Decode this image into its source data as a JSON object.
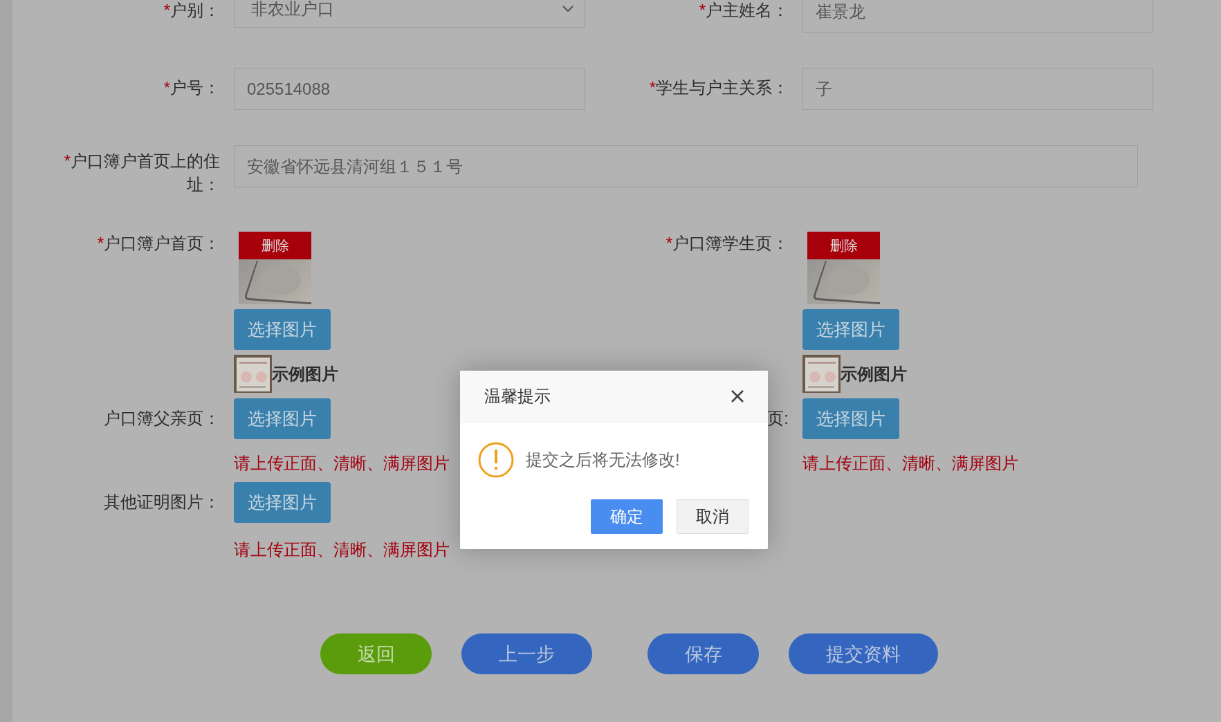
{
  "form": {
    "rows": [
      {
        "fields": [
          {
            "mark": "*",
            "label": "户别：",
            "kind": "select",
            "value": "非农业户口"
          },
          {
            "mark": "*",
            "label": "户主姓名：",
            "kind": "text",
            "value": "崔景龙"
          }
        ]
      },
      {
        "fields": [
          {
            "mark": "*",
            "label": "户号：",
            "kind": "text",
            "value": "025514088"
          },
          {
            "mark": "*",
            "label": "学生与户主关系：",
            "kind": "text",
            "value": "子"
          }
        ]
      },
      {
        "fields": [
          {
            "mark": "*",
            "label": "户口簿户首页上的住址：",
            "kind": "wide",
            "value": "安徽省怀远县清河组１５１号"
          }
        ]
      }
    ],
    "uploads": [
      {
        "items": [
          {
            "mark": "*",
            "label": "户口簿户首页：",
            "delete": "删除",
            "button": "选择图片",
            "example": "示例图片"
          },
          {
            "mark": "*",
            "label": "户口簿学生页：",
            "delete": "删除",
            "button": "选择图片",
            "example": "示例图片"
          }
        ]
      },
      {
        "items": [
          {
            "label": "户口簿父亲页：",
            "button": "选择图片",
            "hint": "请上传正面、清晰、满屏图片"
          },
          {
            "label": "页:",
            "button": "选择图片",
            "hint": "请上传正面、清晰、满屏图片"
          }
        ]
      },
      {
        "items": [
          {
            "label": "其他证明图片：",
            "button": "选择图片",
            "hint": "请上传正面、清晰、满屏图片"
          }
        ]
      }
    ]
  },
  "actions": [
    {
      "label": "返回",
      "kind": "back"
    },
    {
      "label": "上一步",
      "kind": "prev"
    },
    {
      "label": "保存",
      "kind": "save"
    },
    {
      "label": "提交资料",
      "kind": "submit"
    }
  ],
  "dialog": {
    "title": "温馨提示",
    "message": "提交之后将无法修改!",
    "buttons": [
      {
        "label": "确定",
        "kind": "confirm"
      },
      {
        "label": "取消",
        "kind": "cancel"
      }
    ]
  }
}
